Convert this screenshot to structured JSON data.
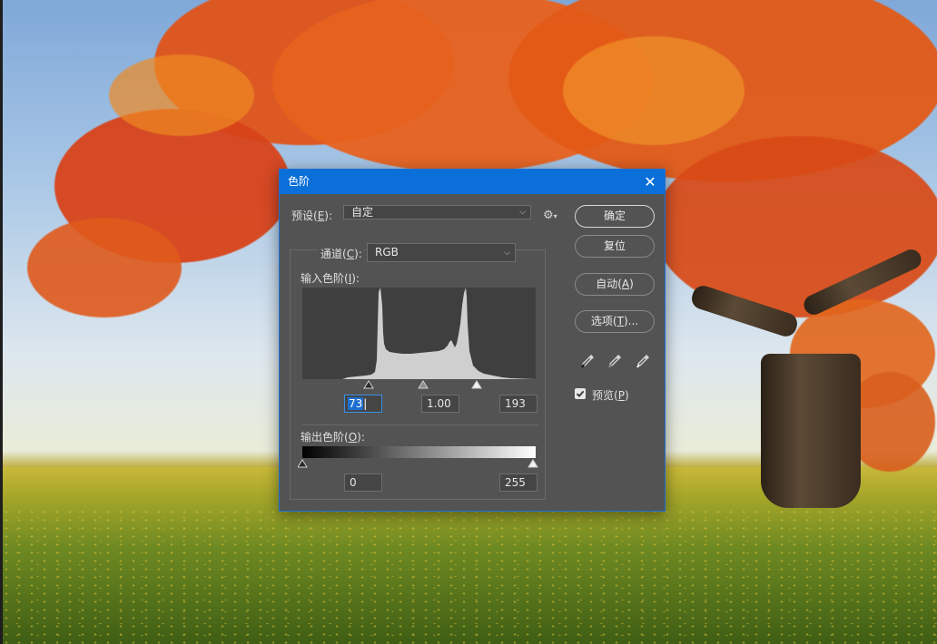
{
  "dialog": {
    "title": "色阶",
    "preset": {
      "label_prefix": "预设(",
      "label_key": "E",
      "label_suffix": "):",
      "value": "自定"
    },
    "channel": {
      "label_prefix": "通道(",
      "label_key": "C",
      "label_suffix": "):",
      "value": "RGB"
    },
    "input_levels": {
      "label_prefix": "输入色阶(",
      "label_key": "I",
      "label_suffix": "):",
      "black": "73",
      "gamma": "1.00",
      "white": "193",
      "slider_fractions": {
        "black": 0.286,
        "gamma": 0.52,
        "white": 0.757
      }
    },
    "output_levels": {
      "label_prefix": "输出色阶(",
      "label_key": "O",
      "label_suffix": "):",
      "black": "0",
      "white": "255"
    },
    "buttons": {
      "ok": "确定",
      "reset": "复位",
      "auto": {
        "prefix": "自动(",
        "key": "A",
        "suffix": ")"
      },
      "options": {
        "prefix": "选项(",
        "key": "T",
        "suffix": ")..."
      }
    },
    "preview": {
      "prefix": "预览(",
      "key": "P",
      "suffix": ")",
      "checked": true
    },
    "icons": [
      "close-icon",
      "gear-icon",
      "black-eyedropper-icon",
      "gray-eyedropper-icon",
      "white-eyedropper-icon",
      "check-icon"
    ],
    "accent": "#0a6fd8",
    "dialog_bg": "#535353"
  }
}
